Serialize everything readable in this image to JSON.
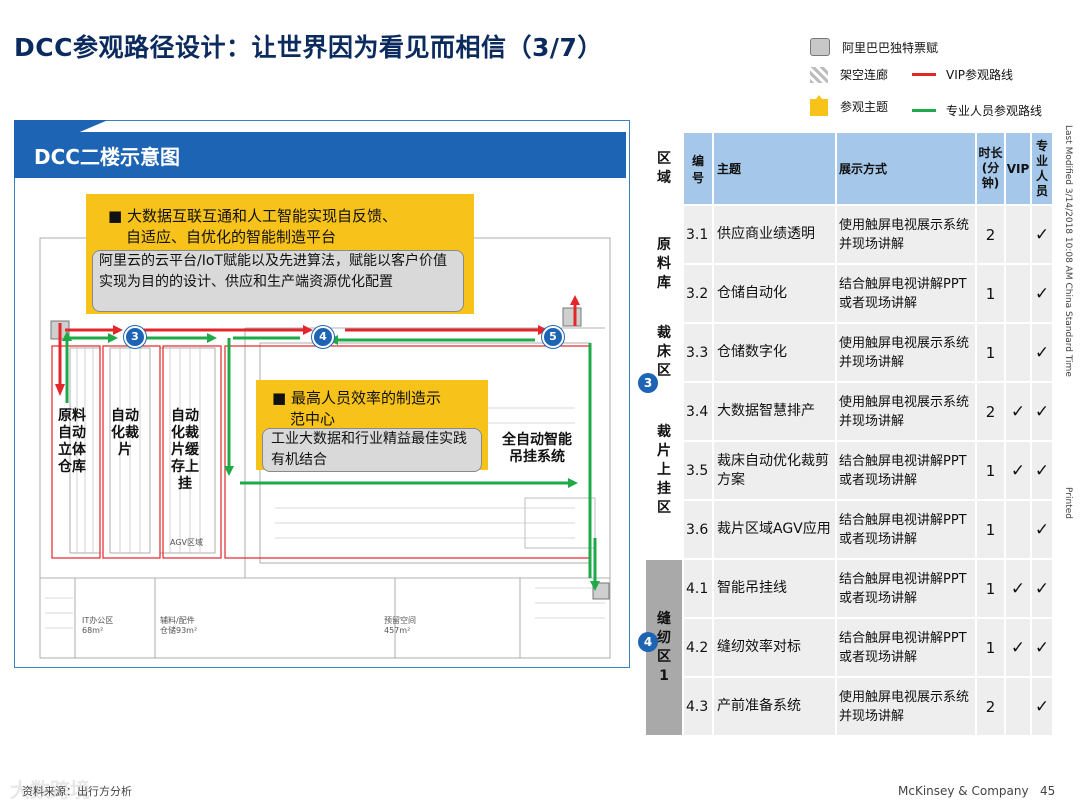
{
  "title": "DCC参观路径设计：让世界因为看见而相信（3/7）",
  "legend": {
    "ticket": "阿里巴巴独特票赋",
    "corridor": "架空连廊",
    "vip_route": "VIP参观路线",
    "topic": "参观主题",
    "pro_route": "专业人员参观路线"
  },
  "colors": {
    "vip": "#e3262a",
    "pro": "#1faa4a",
    "accent": "#1e64b4",
    "yellow": "#f7c31b"
  },
  "panel": {
    "title": "DCC二楼示意图",
    "callout1": {
      "heading1": "大数据互联互通和人工智能实现自反馈、",
      "heading2": "自适应、自优化的智能制造平台",
      "body": "阿里云的云平台/IoT赋能以及先进算法，赋能以客户价值实现为目的的设计、供应和生产端资源优化配置"
    },
    "callout2": {
      "heading1": "最高人员效率的制造示",
      "heading2": "范中心",
      "body": "工业大数据和行业精益最佳实践有机结合"
    },
    "zones": {
      "z1": "原料自动立体仓库",
      "z2": "自动化裁片",
      "z3": "自动化裁片缓存上挂",
      "z4": "全自动智能吊挂系统"
    },
    "badges": {
      "b3": "3",
      "b4": "4",
      "b5": "5"
    },
    "plan_labels": {
      "it": "IT办公区",
      "it_area": "68m²",
      "fabric": "辅料/配件",
      "fabric_area": "仓储93m²",
      "reserve": "预留空间",
      "reserve_area": "457m²",
      "agv": "AGV区域"
    }
  },
  "table": {
    "headers": {
      "area": "区域",
      "num": "编号",
      "topic": "主题",
      "mode": "展示方式",
      "time": "时长(分钟)",
      "vip": "VIP",
      "pro": "专业人员"
    },
    "areas": [
      {
        "label": "原料库",
        "badge": ""
      },
      {
        "label": "裁床区",
        "badge": "3"
      },
      {
        "label": "裁片上挂区",
        "badge": ""
      },
      {
        "label": "缝纫区1",
        "badge": "4"
      }
    ],
    "rows": [
      {
        "num": "3.1",
        "topic": "供应商业绩透明",
        "mode": "使用触屏电视展示系统并现场讲解",
        "time": "2",
        "vip": "",
        "pro": "✓"
      },
      {
        "num": "3.2",
        "topic": "仓储自动化",
        "mode": "结合触屏电视讲解PPT或者现场讲解",
        "time": "1",
        "vip": "",
        "pro": "✓"
      },
      {
        "num": "3.3",
        "topic": "仓储数字化",
        "mode": "使用触屏电视展示系统并现场讲解",
        "time": "1",
        "vip": "",
        "pro": "✓"
      },
      {
        "num": "3.4",
        "topic": "大数据智慧排产",
        "mode": "使用触屏电视展示系统并现场讲解",
        "time": "2",
        "vip": "✓",
        "pro": "✓"
      },
      {
        "num": "3.5",
        "topic": "裁床自动优化裁剪方案",
        "mode": "结合触屏电视讲解PPT或者现场讲解",
        "time": "1",
        "vip": "✓",
        "pro": "✓"
      },
      {
        "num": "3.6",
        "topic": "裁片区域AGV应用",
        "mode": "结合触屏电视讲解PPT或者现场讲解",
        "time": "1",
        "vip": "",
        "pro": "✓"
      },
      {
        "num": "4.1",
        "topic": "智能吊挂线",
        "mode": "结合触屏电视讲解PPT或者现场讲解",
        "time": "1",
        "vip": "✓",
        "pro": "✓"
      },
      {
        "num": "4.2",
        "topic": "缝纫效率对标",
        "mode": "结合触屏电视讲解PPT或者现场讲解",
        "time": "1",
        "vip": "✓",
        "pro": "✓"
      },
      {
        "num": "4.3",
        "topic": "产前准备系统",
        "mode": "使用触屏电视展示系统并现场讲解",
        "time": "2",
        "vip": "",
        "pro": "✓"
      }
    ]
  },
  "side_notes": {
    "modified": "Last Modified 3/14/2018 10:08 AM China Standard Time",
    "printed": "Printed"
  },
  "footer": {
    "source": "资料来源：出行方分析",
    "watermark": "大数跨境",
    "company": "McKinsey & Company",
    "page": "45"
  }
}
